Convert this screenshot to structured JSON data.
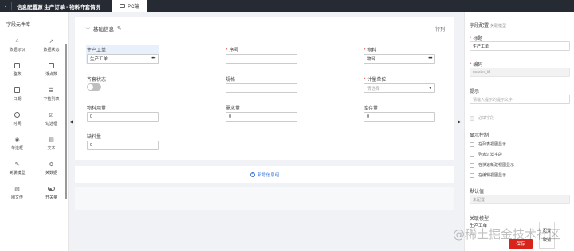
{
  "header": {
    "back_icon": "chevron-left-icon",
    "title": "信息配置源 生产订单 - 物料齐套情况",
    "tab_icon": "monitor-icon",
    "tab_label": "PC端"
  },
  "left_panel": {
    "title": "字段元件库",
    "items": [
      {
        "label": "数据标识",
        "icon": "tag-icon"
      },
      {
        "label": "数据状态",
        "icon": "status-icon"
      },
      {
        "label": "整数",
        "icon": "integer-icon"
      },
      {
        "label": "浮点数",
        "icon": "decimal-icon"
      },
      {
        "label": "日期",
        "icon": "calendar-icon"
      },
      {
        "label": "下拉列表",
        "icon": "dropdown-icon"
      },
      {
        "label": "时间",
        "icon": "clock-icon"
      },
      {
        "label": "勾选框",
        "icon": "checkbox-icon"
      },
      {
        "label": "单选框",
        "icon": "radio-icon"
      },
      {
        "label": "文本",
        "icon": "text-icon"
      },
      {
        "label": "关联模型",
        "icon": "link-model-icon"
      },
      {
        "label": "关数据",
        "icon": "settings-icon"
      },
      {
        "label": "图文传",
        "icon": "image-text-icon"
      },
      {
        "label": "开关量",
        "icon": "toggle-icon"
      }
    ]
  },
  "section": {
    "title": "基础信息",
    "right_label": "行列",
    "fields": {
      "production_order": {
        "label": "生产工单",
        "value": "生产工单",
        "required": false
      },
      "serial_no": {
        "label": "序号",
        "value": "",
        "required": true
      },
      "material": {
        "label": "物料",
        "value": "物料",
        "required": true
      },
      "kit_status": {
        "label": "齐套状态",
        "required": false
      },
      "spec": {
        "label": "规格",
        "value": "",
        "required": false
      },
      "unit": {
        "label": "计量单位",
        "placeholder": "请选择",
        "required": true
      },
      "material_usage": {
        "label": "物料用量",
        "value": "0"
      },
      "demand_qty": {
        "label": "需求量",
        "value": "0"
      },
      "stock_qty": {
        "label": "库存量",
        "value": "0"
      },
      "shortage_qty": {
        "label": "缺料量",
        "value": "0"
      }
    }
  },
  "add_section_label": "新增信息组",
  "right_panel": {
    "title": "字段配置",
    "subtitle": "关联模型",
    "title_label": "标题",
    "title_value": "生产工单",
    "code_label": "编码",
    "code_value": "master_id",
    "hint_label": "提示",
    "hint_placeholder": "请输入提示的提示文字",
    "required_field": "必填字段",
    "display_control": "显示控制",
    "display_options": [
      "在列表视图显示",
      "列表过滤字段",
      "在快速新建视图显示",
      "在编辑视图显示"
    ],
    "default_label": "默认值",
    "default_placeholder": "未配置",
    "relation_label": "关联模型",
    "relation_value": "生产工单",
    "config_label": "配置",
    "cancel_label": "取消",
    "save_label": "保存"
  },
  "watermark": "@稀土掘金技术社区"
}
